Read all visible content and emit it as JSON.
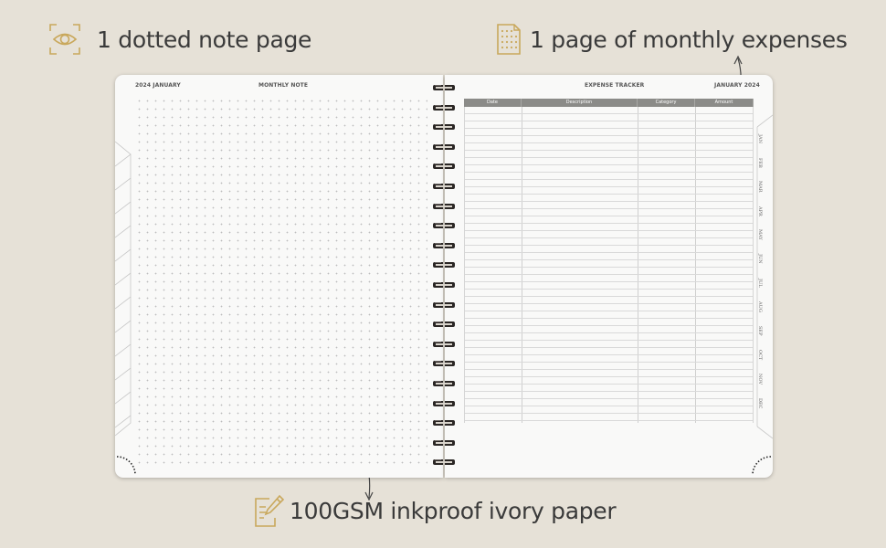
{
  "features": {
    "dotted": {
      "label": "1 dotted note page",
      "icon": "eye-icon"
    },
    "expense": {
      "label": "1 page of monthly expenses",
      "icon": "dotted-page-icon"
    },
    "paper": {
      "label": "100GSM inkproof ivory paper",
      "icon": "pen-paper-icon"
    }
  },
  "left_page": {
    "date": "2024 JANUARY",
    "title": "MONTHLY NOTE"
  },
  "right_page": {
    "title": "EXPENSE TRACKER",
    "date": "JANUARY 2024",
    "columns": [
      "Date",
      "Description",
      "Category",
      "Amount"
    ]
  },
  "month_tabs": [
    "JAN",
    "FEB",
    "MAR",
    "APR",
    "MAY",
    "JUN",
    "JUL",
    "AUG",
    "SEP",
    "OCT",
    "NOV",
    "DEC"
  ],
  "colors": {
    "background": "#e6e1d7",
    "accent_gold": "#c9a85c",
    "text": "#3a3a3a",
    "table_header": "#8b8b88",
    "spiral": "#2a2624"
  }
}
